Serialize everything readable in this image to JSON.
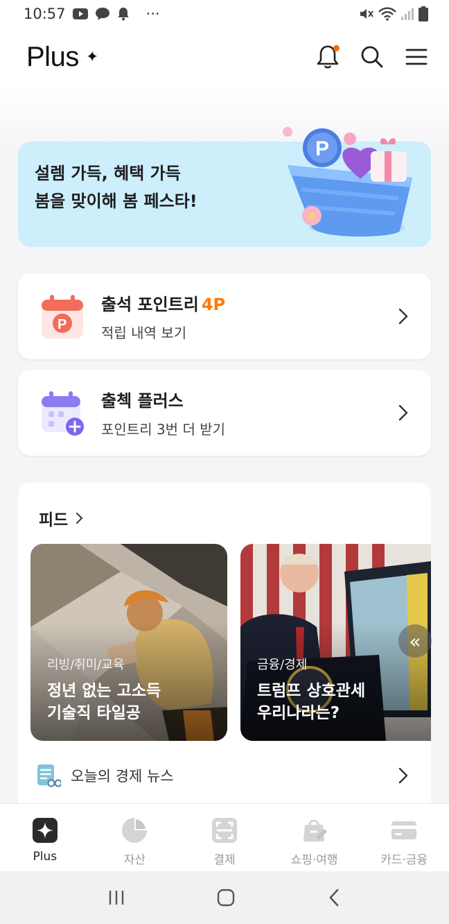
{
  "status_bar": {
    "time": "10:57",
    "dots": "···"
  },
  "header": {
    "logo": "Plus",
    "logo_sparkle": "✦"
  },
  "banner": {
    "line1": "설렘 가득, 혜택 가득",
    "line2": "봄을 맞이해 봄 페스타!"
  },
  "cards": [
    {
      "title": "출석 포인트리",
      "points": "4P",
      "subtitle": "적립 내역 보기"
    },
    {
      "title": "출첵 플러스",
      "subtitle": "포인트리 3번 더 받기"
    }
  ],
  "feed": {
    "title": "피드",
    "items": [
      {
        "category": "리빙/취미/교육",
        "headline_1": "정년 없는 고소득",
        "headline_2": "기술직 타일공"
      },
      {
        "category": "금융/경제",
        "headline_1": "트럼프 상호관세",
        "headline_2": "우리나라는?"
      }
    ],
    "scroll_glyph": "«",
    "news_label": "오늘의 경제 뉴스"
  },
  "bottom_nav": [
    {
      "label": "Plus",
      "icon": "plus-sparkle-icon",
      "active": true
    },
    {
      "label": "자산",
      "icon": "pie-chart-icon",
      "active": false
    },
    {
      "label": "결제",
      "icon": "scan-icon",
      "active": false
    },
    {
      "label": "쇼핑·여행",
      "icon": "shopping-bag-icon",
      "active": false
    },
    {
      "label": "카드·금융",
      "icon": "card-icon",
      "active": false
    }
  ],
  "colors": {
    "accent": "#ff7a00",
    "banner_bg": "#cdeefb",
    "page_bg": "#f6f6f8"
  }
}
